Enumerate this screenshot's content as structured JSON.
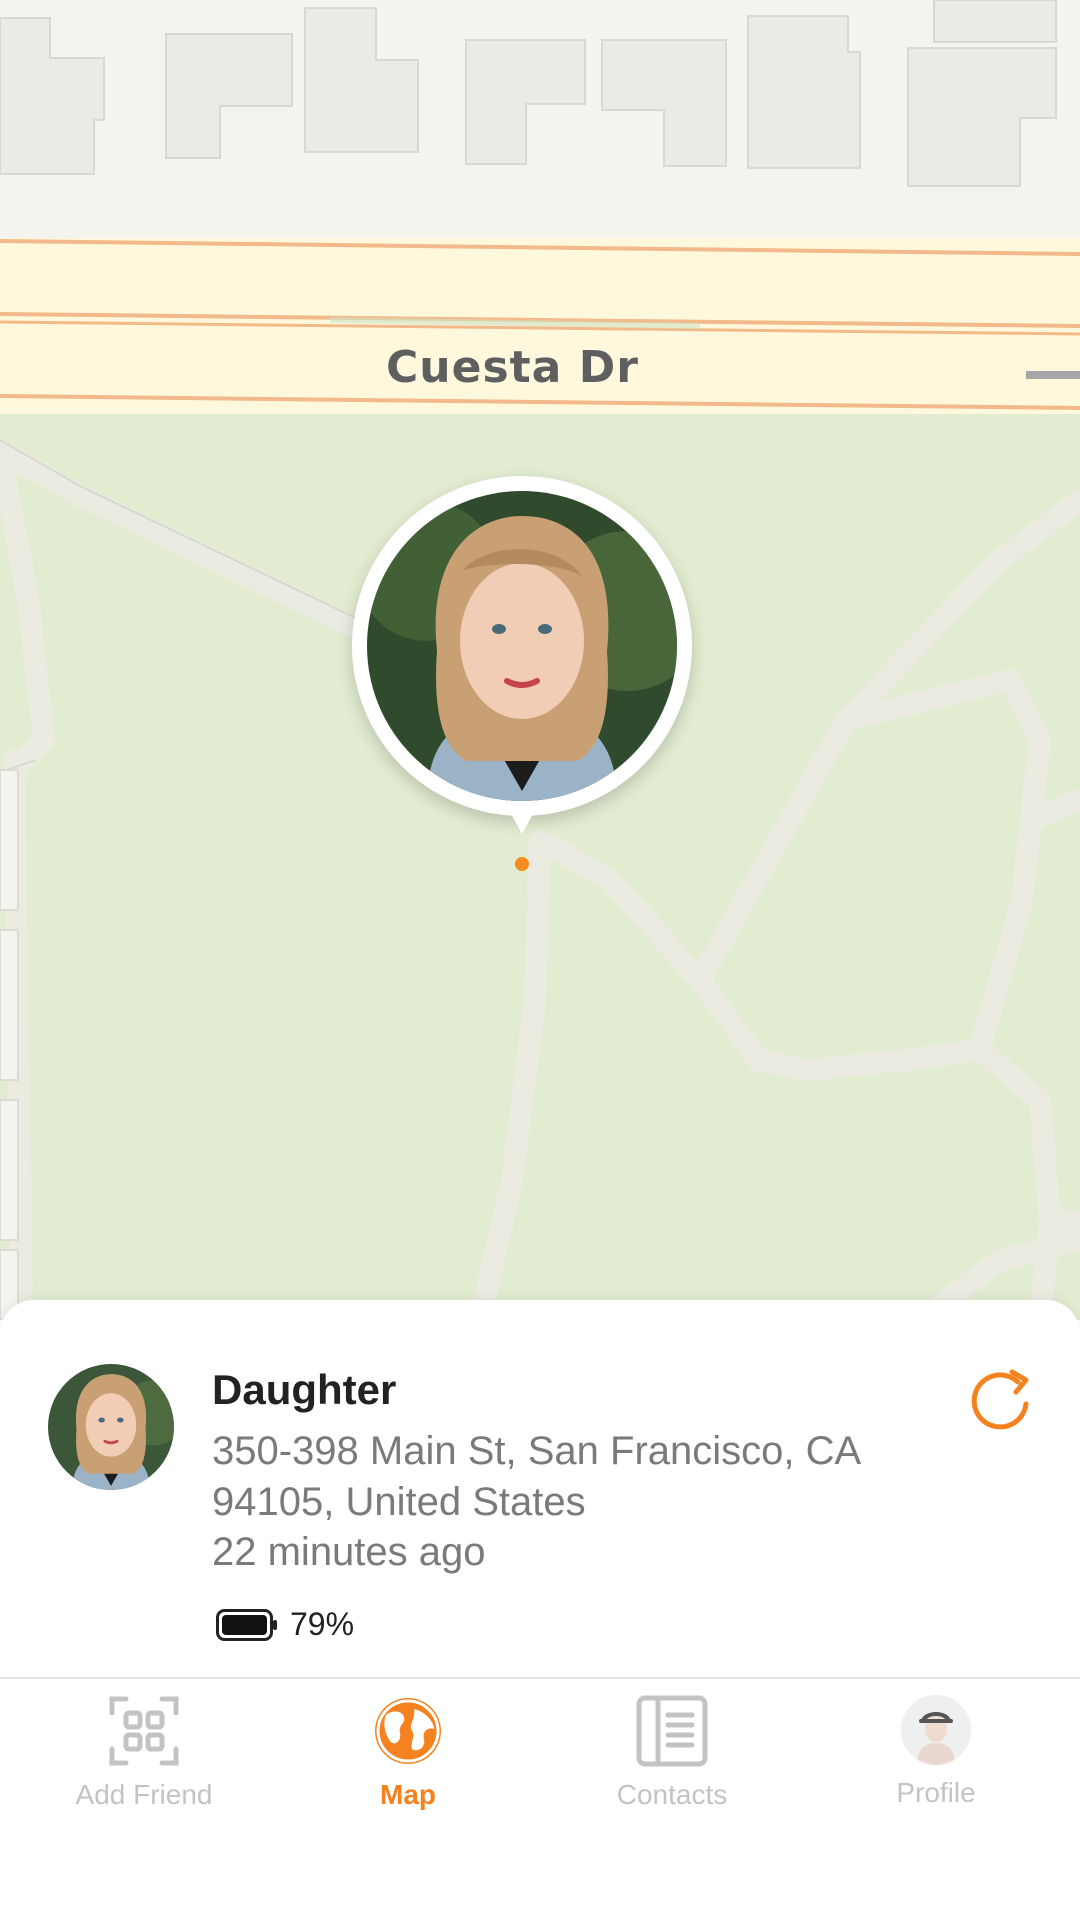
{
  "map": {
    "street_label": "Cuesta Dr"
  },
  "location_card": {
    "name": "Daughter",
    "address": "350-398 Main St, San Francisco, CA 94105, United States",
    "last_seen": "22 minutes ago",
    "battery": "79%",
    "battery_level": 0.79
  },
  "tabs": [
    {
      "label": "Add Friend",
      "icon": "qr-code-icon",
      "active": false
    },
    {
      "label": "Map",
      "icon": "globe-icon",
      "active": true
    },
    {
      "label": "Contacts",
      "icon": "contacts-list-icon",
      "active": false
    },
    {
      "label": "Profile",
      "icon": "avatar",
      "active": false
    }
  ],
  "colors": {
    "accent": "#f5821f",
    "inactive": "#c3c3c3",
    "park": "#e1ecd0",
    "road": "#fffbe6",
    "road_edge": "#f2b98a"
  }
}
